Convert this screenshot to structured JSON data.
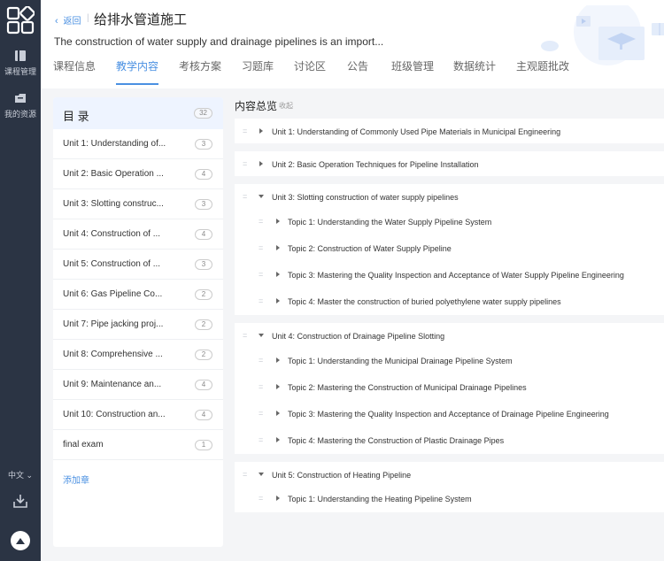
{
  "sidebar": {
    "logo": "app-logo",
    "items": [
      {
        "label": "课程管理",
        "icon": "book-icon"
      },
      {
        "label": "我的资源",
        "icon": "folder-icon"
      }
    ],
    "language": "中文",
    "download_icon": "download-icon"
  },
  "header": {
    "back_label": "返回",
    "title": "给排水管道施工",
    "description": "The construction of water supply and drainage pipelines is an import...",
    "tabs": [
      "课程信息",
      "教学内容",
      "考核方案",
      "习题库",
      "讨论区",
      "公告",
      "班级管理",
      "数据统计",
      "主观题批改"
    ],
    "active_tab": "教学内容"
  },
  "toc": {
    "title": "目 录",
    "total": "32",
    "items": [
      {
        "label": "Unit 1: Understanding of...",
        "count": "3"
      },
      {
        "label": "Unit 2: Basic Operation ...",
        "count": "4"
      },
      {
        "label": "Unit 3: Slotting construc...",
        "count": "3"
      },
      {
        "label": "Unit 4: Construction of ...",
        "count": "4"
      },
      {
        "label": "Unit 5: Construction of ...",
        "count": "3"
      },
      {
        "label": "Unit 6: Gas Pipeline Co...",
        "count": "2"
      },
      {
        "label": "Unit 7: Pipe jacking proj...",
        "count": "2"
      },
      {
        "label": "Unit 8: Comprehensive ...",
        "count": "2"
      },
      {
        "label": "Unit 9: Maintenance an...",
        "count": "4"
      },
      {
        "label": "Unit 10: Construction an...",
        "count": "4"
      },
      {
        "label": "final exam",
        "count": "1"
      }
    ],
    "add_label": "添加章"
  },
  "overview": {
    "title": "内容总览",
    "collapse_label": "收起",
    "units": [
      {
        "label": "Unit 1: Understanding of Commonly Used Pipe Materials in Municipal Engineering",
        "expanded": false,
        "topics": []
      },
      {
        "label": "Unit 2: Basic Operation Techniques for Pipeline Installation",
        "expanded": false,
        "topics": []
      },
      {
        "label": "Unit 3: Slotting construction of water supply pipelines",
        "expanded": true,
        "topics": [
          "Topic 1: Understanding the Water Supply Pipeline System",
          "Topic 2: Construction of Water Supply Pipeline",
          "Topic 3: Mastering the Quality Inspection and Acceptance of Water Supply Pipeline Engineering",
          "Topic 4: Master the construction of buried polyethylene water supply pipelines"
        ]
      },
      {
        "label": "Unit 4: Construction of Drainage Pipeline Slotting",
        "expanded": true,
        "topics": [
          "Topic 1: Understanding the Municipal Drainage Pipeline System",
          "Topic 2: Mastering the Construction of Municipal Drainage Pipelines",
          "Topic 3: Mastering the Quality Inspection and Acceptance of Drainage Pipeline Engineering",
          "Topic 4: Mastering the Construction of Plastic Drainage Pipes"
        ]
      },
      {
        "label": "Unit 5: Construction of Heating Pipeline",
        "expanded": true,
        "topics": [
          "Topic 1: Understanding the Heating Pipeline System"
        ]
      }
    ]
  },
  "colors": {
    "accent": "#4a90e2",
    "rail": "#2b3444",
    "toc_header": "#eef4ff"
  }
}
